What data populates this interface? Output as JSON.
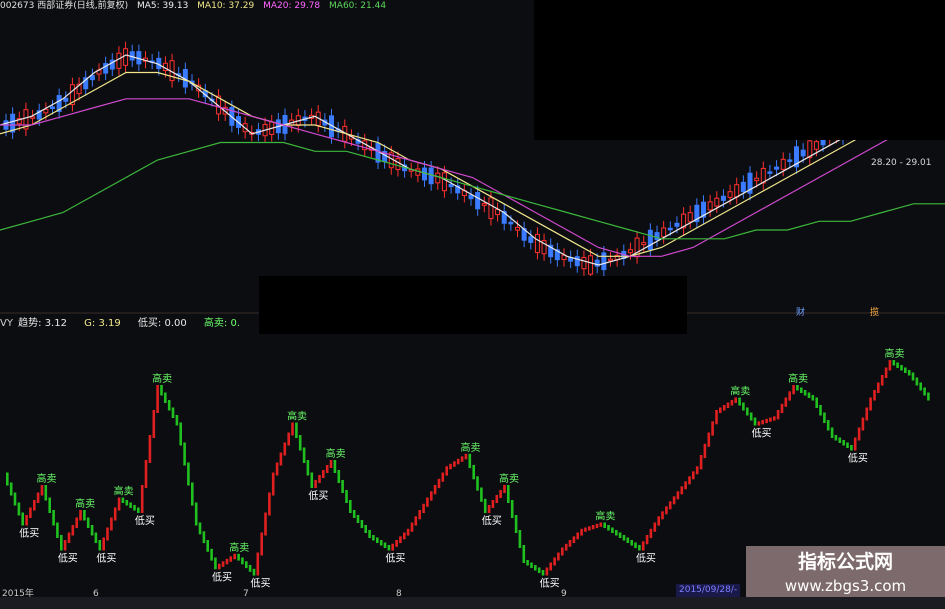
{
  "header": {
    "title": "002673 西部证券(日线,前复权)",
    "ma5": "MA5: 39.13",
    "ma10": "MA10: 37.29",
    "ma20": "MA20: 29.78",
    "ma60": "MA60: 21.44"
  },
  "indicator_header": {
    "prefix": "VY",
    "trend": "趋势: 3.12",
    "g": "G: 3.19",
    "low_buy": "低买: 0.00",
    "high_sell": "高卖: 0."
  },
  "axis": {
    "year": "2015年",
    "months": [
      "6",
      "7",
      "8",
      "9"
    ]
  },
  "price_range_label": "28.20 - 29.01",
  "markers": {
    "cai": "财",
    "lan": "揽"
  },
  "date_box": "2015/09/28/-",
  "watermark": {
    "title": "指标公式网",
    "url": "www.zbgs3.com"
  },
  "colors": {
    "up_candle": "#ff3030",
    "down_candle": "#3a7bff",
    "ma5": "#e8e8e8",
    "ma10": "#f0e68c",
    "ma20": "#d04ad0",
    "ma60": "#3cb83c",
    "trend_up": "#e02020",
    "trend_down": "#20c020",
    "high_sell": "#6aff6a",
    "low_buy": "#ffffff"
  },
  "chart_data": [
    {
      "type": "candlestick",
      "title": "002673 西部证券(日线,前复权)",
      "series": [
        {
          "name": "MA5",
          "values": [
            30,
            31,
            33,
            36,
            38,
            37,
            35,
            32,
            29,
            30,
            31,
            29,
            27,
            25,
            24,
            22,
            20,
            17,
            15,
            14,
            15,
            17,
            19,
            21,
            23,
            25,
            27,
            29,
            31,
            33,
            39
          ]
        },
        {
          "name": "MA10",
          "values": [
            29,
            30,
            32,
            34,
            36,
            36,
            35,
            33,
            31,
            30,
            30,
            29,
            28,
            26,
            25,
            23,
            21,
            19,
            17,
            15,
            15,
            16,
            18,
            20,
            22,
            24,
            26,
            28,
            30,
            32,
            37
          ]
        },
        {
          "name": "MA20",
          "values": [
            30,
            30,
            31,
            32,
            33,
            33,
            33,
            32,
            31,
            30,
            29,
            28,
            27,
            26,
            25,
            24,
            22,
            20,
            18,
            16,
            15,
            15,
            16,
            18,
            20,
            22,
            24,
            26,
            28,
            30,
            30
          ]
        },
        {
          "name": "MA60",
          "values": [
            18,
            19,
            20,
            22,
            24,
            26,
            27,
            28,
            28,
            28,
            27,
            27,
            26,
            25,
            24,
            23,
            22,
            21,
            20,
            19,
            18,
            17,
            17,
            17,
            18,
            18,
            19,
            19,
            20,
            21,
            21
          ]
        }
      ],
      "x_labels": [
        "2015年",
        "6",
        "7",
        "8",
        "9"
      ]
    },
    {
      "type": "line",
      "title": "趋势",
      "series": [
        {
          "name": "趋势",
          "values": [
            1.8,
            1.0,
            1.6,
            0.6,
            1.2,
            0.6,
            1.4,
            1.2,
            3.2,
            2.6,
            1.0,
            0.3,
            0.5,
            0.2,
            1.8,
            2.6,
            1.6,
            2.0,
            1.2,
            0.8,
            0.6,
            0.9,
            1.4,
            1.9,
            2.1,
            1.2,
            1.6,
            0.4,
            0.2,
            0.6,
            0.9,
            1.0,
            0.8,
            0.6,
            1.1,
            1.5,
            1.9,
            2.8,
            3.0,
            2.6,
            2.7,
            3.2,
            3.0,
            2.4,
            2.2,
            3.0,
            3.6,
            3.4,
            3.0
          ]
        }
      ],
      "annotations": [
        "高卖",
        "低买"
      ]
    }
  ]
}
